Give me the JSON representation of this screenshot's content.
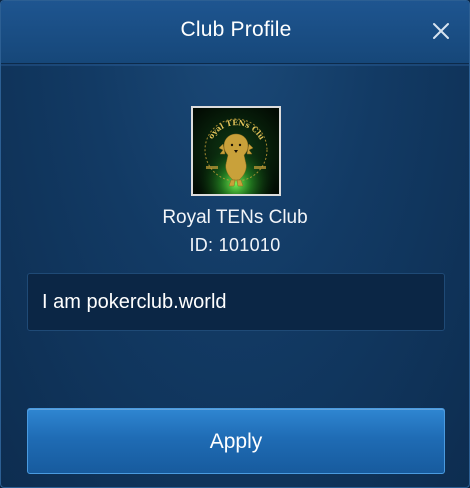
{
  "dialog": {
    "title": "Club Profile",
    "close_icon": "close-icon"
  },
  "club": {
    "logo_icon": "club-logo-lion",
    "logo_text": "Royal TENs Club",
    "name": "Royal TENs Club",
    "id_text": "ID: 101010",
    "description": "I am pokerclub.world"
  },
  "actions": {
    "apply_label": "Apply"
  },
  "colors": {
    "accent": "#1f6cb5",
    "logo_gold": "#c9a13a",
    "logo_green": "#3fd23a"
  }
}
